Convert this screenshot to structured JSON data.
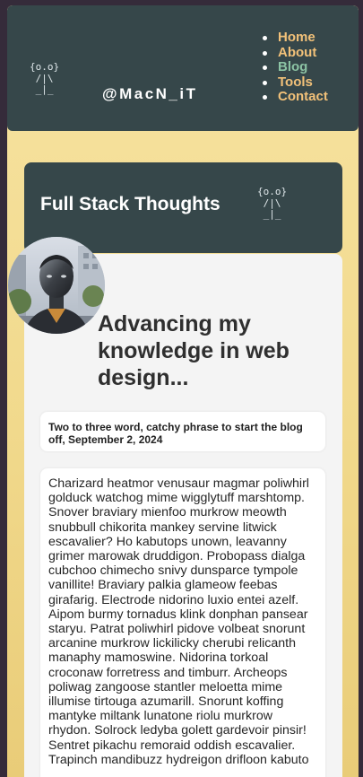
{
  "header": {
    "logo_ascii": "{o.o}\n /|\\\n _|_",
    "handle": "@MacN_iT",
    "nav": [
      {
        "label": "Home"
      },
      {
        "label": "About"
      },
      {
        "label": "Blog",
        "active": true
      },
      {
        "label": "Tools"
      },
      {
        "label": "Contact"
      }
    ]
  },
  "banner": {
    "title": "Full Stack Thoughts",
    "ascii": "{o.o}\n /|\\\n _|_"
  },
  "post": {
    "title": "Advancing my knowledge in web design...",
    "meta": "Two to three word, catchy phrase to start the blog off, September 2, 2024",
    "body": "Charizard heatmor venusaur magmar poliwhirl golduck watchog mime wigglytuff marshtomp. Snover braviary mienfoo murkrow meowth snubbull chikorita mankey servine litwick escavalier? Ho kabutops unown, leavanny grimer marowak druddigon. Probopass dialga cubchoo chimecho snivy dunsparce tympole vanillite! Braviary palkia glameow feebas girafarig. Electrode nidorino luxio entei azelf. Aipom burmy tornadus klink donphan pansear staryu. Patrat poliwhirl pidove volbeat snorunt arcanine murkrow lickilicky cherubi relicanth manaphy mamoswine. Nidorina torkoal croconaw forretress and timburr. Archeops poliwag zangoose stantler meloetta mime illumise tirtouga azumarill. Snorunt koffing mantyke miltank lunatone riolu murkrow rhydon. Solrock ledyba golett gardevoir pinsir! Sentret pikachu remoraid oddish escavalier. Trapinch mandibuzz hydreigon drifloon kabuto"
  },
  "colors": {
    "header_bg": "#36474a",
    "page_bg": "#f1d98c",
    "nav_link": "#f2c179",
    "nav_active": "#8cc3a4"
  }
}
